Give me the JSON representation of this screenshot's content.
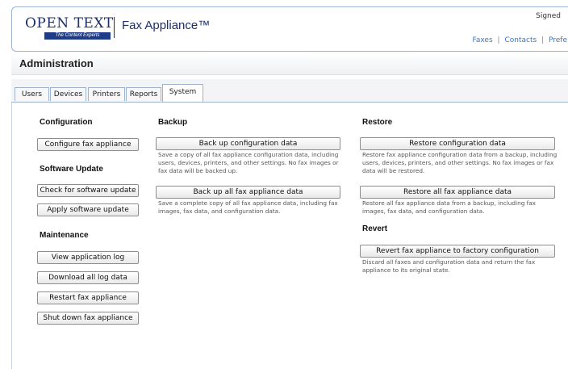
{
  "header": {
    "logo_word": "OPEN TEXT",
    "logo_tagline": "The Content Experts",
    "product_name": "Fax Appliance™",
    "signed_text": "Signed",
    "links": [
      "Faxes",
      "Contacts",
      "Prefe"
    ],
    "separator": "|"
  },
  "page": {
    "title": "Administration"
  },
  "tabs": [
    {
      "label": "Users",
      "active": false
    },
    {
      "label": "Devices",
      "active": false
    },
    {
      "label": "Printers",
      "active": false
    },
    {
      "label": "Reports",
      "active": false
    },
    {
      "label": "System",
      "active": true
    }
  ],
  "left": {
    "configuration_title": "Configuration",
    "configure_button": "Configure fax appliance",
    "software_update_title": "Software Update",
    "check_update_button": "Check for software update",
    "apply_update_button": "Apply software update",
    "maintenance_title": "Maintenance",
    "view_log_button": "View application log",
    "download_logs_button": "Download all log data",
    "restart_button": "Restart fax appliance",
    "shutdown_button": "Shut down fax appliance"
  },
  "backup": {
    "title": "Backup",
    "config_button": "Back up configuration data",
    "config_desc": "Save a copy of all fax appliance configuration data, including users, devices, printers, and other settings. No fax images or fax data will be backed up.",
    "all_button": "Back up all fax appliance data",
    "all_desc": "Save a complete copy of all fax appliance data, including fax images, fax data, and configuration data."
  },
  "restore": {
    "title": "Restore",
    "config_button": "Restore configuration data",
    "config_desc": "Restore fax appliance configuration data from a backup, including users, devices, printers, and other settings. No fax images or fax data will be restored.",
    "all_button": "Restore all fax appliance data",
    "all_desc": "Restore all fax appliance data from a backup, including fax images, fax data, and configuration data."
  },
  "revert": {
    "title": "Revert",
    "button": "Revert fax appliance to factory configuration",
    "desc": "Discard all faxes and configuration data and return the fax appliance to its original state."
  }
}
